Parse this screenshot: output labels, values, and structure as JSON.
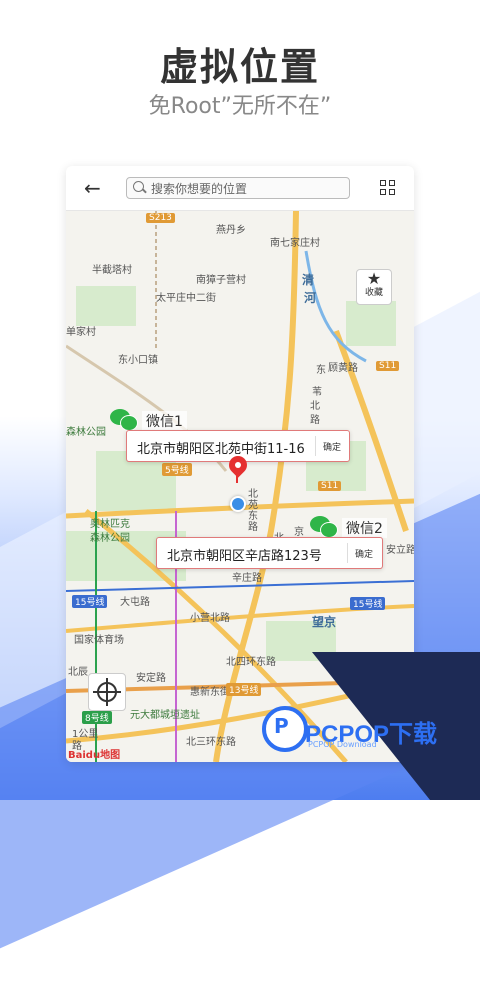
{
  "hero": {
    "title": "虚拟位置",
    "subtitle": "免Root”无所不在”"
  },
  "toolbar": {
    "back_icon": "arrow-left-icon",
    "search_placeholder": "搜索你想要的位置",
    "grid_icon": "grid-icon"
  },
  "map": {
    "labels": {
      "l1": "燕丹乡",
      "l2": "南七家庄村",
      "l3": "半截塔村",
      "l4": "南獐子营村",
      "l5": "清",
      "l6": "河",
      "l7": "太平庄中二街",
      "l8": "单家村",
      "l9": "东小口镇",
      "l10": "顾黄路",
      "l11": "森林公园",
      "l12": "奥林匹克",
      "l13": "森林公园",
      "l14": "辛庄路",
      "l15": "大屯路",
      "l16": "小营北路",
      "l17": "望京",
      "l18": "国家体育场",
      "l19": "北四环东路",
      "l20": "北辰",
      "l21": "安定路",
      "l22": "惠新东街",
      "l23": "元大都城垣遗址",
      "l24": "1公里",
      "l25": "北三环东路",
      "l26": "路",
      "l27": "北苑东路",
      "l28": "北",
      "l29": "京",
      "l30": "安立路",
      "l31": "东",
      "l32": "苇",
      "l33": "北",
      "l34": "路"
    },
    "routes": {
      "s213": "S213",
      "s11a": "S11",
      "s11b": "S11",
      "line5": "5号线",
      "line15a": "15号线",
      "line15b": "15号线",
      "line13": "13号线",
      "line8": "8号线"
    },
    "favorite": {
      "icon": "star-icon",
      "label": "收藏"
    },
    "markers": [
      {
        "label": "微信1",
        "address": "北京市朝阳区北苑中街11-16",
        "confirm": "确定"
      },
      {
        "label": "微信2",
        "address": "北京市朝阳区辛店路123号",
        "confirm": "确定"
      }
    ],
    "locate_icon": "crosshair-icon",
    "attribution": "Baidu地图"
  },
  "watermark": {
    "logo_letter": "P",
    "text": "PCPOP下载",
    "sub": "PCPOP Download"
  }
}
